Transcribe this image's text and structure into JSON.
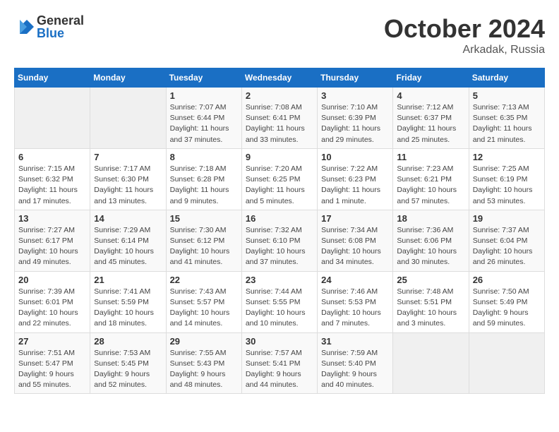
{
  "logo": {
    "general": "General",
    "blue": "Blue"
  },
  "title": "October 2024",
  "location": "Arkadak, Russia",
  "weekdays": [
    "Sunday",
    "Monday",
    "Tuesday",
    "Wednesday",
    "Thursday",
    "Friday",
    "Saturday"
  ],
  "days": [
    {
      "date": "",
      "info": ""
    },
    {
      "date": "",
      "info": ""
    },
    {
      "date": "1",
      "info": "Sunrise: 7:07 AM\nSunset: 6:44 PM\nDaylight: 11 hours and 37 minutes."
    },
    {
      "date": "2",
      "info": "Sunrise: 7:08 AM\nSunset: 6:41 PM\nDaylight: 11 hours and 33 minutes."
    },
    {
      "date": "3",
      "info": "Sunrise: 7:10 AM\nSunset: 6:39 PM\nDaylight: 11 hours and 29 minutes."
    },
    {
      "date": "4",
      "info": "Sunrise: 7:12 AM\nSunset: 6:37 PM\nDaylight: 11 hours and 25 minutes."
    },
    {
      "date": "5",
      "info": "Sunrise: 7:13 AM\nSunset: 6:35 PM\nDaylight: 11 hours and 21 minutes."
    },
    {
      "date": "6",
      "info": "Sunrise: 7:15 AM\nSunset: 6:32 PM\nDaylight: 11 hours and 17 minutes."
    },
    {
      "date": "7",
      "info": "Sunrise: 7:17 AM\nSunset: 6:30 PM\nDaylight: 11 hours and 13 minutes."
    },
    {
      "date": "8",
      "info": "Sunrise: 7:18 AM\nSunset: 6:28 PM\nDaylight: 11 hours and 9 minutes."
    },
    {
      "date": "9",
      "info": "Sunrise: 7:20 AM\nSunset: 6:25 PM\nDaylight: 11 hours and 5 minutes."
    },
    {
      "date": "10",
      "info": "Sunrise: 7:22 AM\nSunset: 6:23 PM\nDaylight: 11 hours and 1 minute."
    },
    {
      "date": "11",
      "info": "Sunrise: 7:23 AM\nSunset: 6:21 PM\nDaylight: 10 hours and 57 minutes."
    },
    {
      "date": "12",
      "info": "Sunrise: 7:25 AM\nSunset: 6:19 PM\nDaylight: 10 hours and 53 minutes."
    },
    {
      "date": "13",
      "info": "Sunrise: 7:27 AM\nSunset: 6:17 PM\nDaylight: 10 hours and 49 minutes."
    },
    {
      "date": "14",
      "info": "Sunrise: 7:29 AM\nSunset: 6:14 PM\nDaylight: 10 hours and 45 minutes."
    },
    {
      "date": "15",
      "info": "Sunrise: 7:30 AM\nSunset: 6:12 PM\nDaylight: 10 hours and 41 minutes."
    },
    {
      "date": "16",
      "info": "Sunrise: 7:32 AM\nSunset: 6:10 PM\nDaylight: 10 hours and 37 minutes."
    },
    {
      "date": "17",
      "info": "Sunrise: 7:34 AM\nSunset: 6:08 PM\nDaylight: 10 hours and 34 minutes."
    },
    {
      "date": "18",
      "info": "Sunrise: 7:36 AM\nSunset: 6:06 PM\nDaylight: 10 hours and 30 minutes."
    },
    {
      "date": "19",
      "info": "Sunrise: 7:37 AM\nSunset: 6:04 PM\nDaylight: 10 hours and 26 minutes."
    },
    {
      "date": "20",
      "info": "Sunrise: 7:39 AM\nSunset: 6:01 PM\nDaylight: 10 hours and 22 minutes."
    },
    {
      "date": "21",
      "info": "Sunrise: 7:41 AM\nSunset: 5:59 PM\nDaylight: 10 hours and 18 minutes."
    },
    {
      "date": "22",
      "info": "Sunrise: 7:43 AM\nSunset: 5:57 PM\nDaylight: 10 hours and 14 minutes."
    },
    {
      "date": "23",
      "info": "Sunrise: 7:44 AM\nSunset: 5:55 PM\nDaylight: 10 hours and 10 minutes."
    },
    {
      "date": "24",
      "info": "Sunrise: 7:46 AM\nSunset: 5:53 PM\nDaylight: 10 hours and 7 minutes."
    },
    {
      "date": "25",
      "info": "Sunrise: 7:48 AM\nSunset: 5:51 PM\nDaylight: 10 hours and 3 minutes."
    },
    {
      "date": "26",
      "info": "Sunrise: 7:50 AM\nSunset: 5:49 PM\nDaylight: 9 hours and 59 minutes."
    },
    {
      "date": "27",
      "info": "Sunrise: 7:51 AM\nSunset: 5:47 PM\nDaylight: 9 hours and 55 minutes."
    },
    {
      "date": "28",
      "info": "Sunrise: 7:53 AM\nSunset: 5:45 PM\nDaylight: 9 hours and 52 minutes."
    },
    {
      "date": "29",
      "info": "Sunrise: 7:55 AM\nSunset: 5:43 PM\nDaylight: 9 hours and 48 minutes."
    },
    {
      "date": "30",
      "info": "Sunrise: 7:57 AM\nSunset: 5:41 PM\nDaylight: 9 hours and 44 minutes."
    },
    {
      "date": "31",
      "info": "Sunrise: 7:59 AM\nSunset: 5:40 PM\nDaylight: 9 hours and 40 minutes."
    },
    {
      "date": "",
      "info": ""
    },
    {
      "date": "",
      "info": ""
    }
  ]
}
